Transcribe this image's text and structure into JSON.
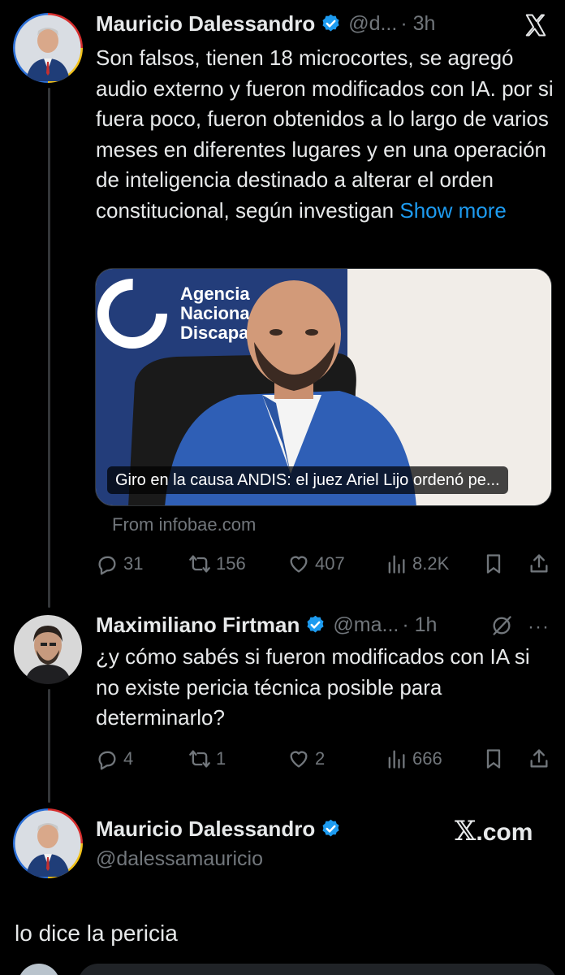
{
  "colors": {
    "background": "#000000",
    "text": "#e7e9ea",
    "muted": "#71767b",
    "link": "#1d9bf0",
    "verified": "#1d9bf0"
  },
  "tweet1": {
    "name": "Mauricio Dalessandro",
    "handle": "@d...",
    "time": "· 3h",
    "text": "Son falsos, tienen 18 microcortes, se agregó audio externo y fueron modificados con IA. por si fuera poco, fueron obtenidos a lo largo de varios meses en diferentes lugares y en una operación de inteligencia destinado a alterar el orden constitucional, según investigan",
    "show_more": "Show more",
    "card": {
      "sign_line1": "Agencia",
      "sign_line2": "Naciona",
      "sign_line3": "Discapa",
      "caption": "Giro en la causa ANDIS: el juez Ariel Lijo ordenó pe..."
    },
    "from": "From infobae.com",
    "stats": {
      "replies": "31",
      "reposts": "156",
      "likes": "407",
      "views": "8.2K"
    },
    "icons": [
      "x-logo-icon",
      "verified-icon",
      "reply-icon",
      "repost-icon",
      "like-icon",
      "views-icon",
      "bookmark-icon",
      "share-icon"
    ]
  },
  "tweet2": {
    "name": "Maximiliano Firtman",
    "handle": "@ma...",
    "time": "· 1h",
    "text": "¿y cómo sabés si fueron modificados con IA si no existe pericia técnica posible para determinarlo?",
    "more": "···",
    "stats": {
      "replies": "4",
      "reposts": "1",
      "likes": "2",
      "views": "666"
    }
  },
  "tweet3": {
    "name": "Mauricio Dalessandro",
    "handle": "@dalessamauricio",
    "brand": ".com",
    "brand_mark": "𝕏",
    "text": "lo dice la pericia"
  }
}
